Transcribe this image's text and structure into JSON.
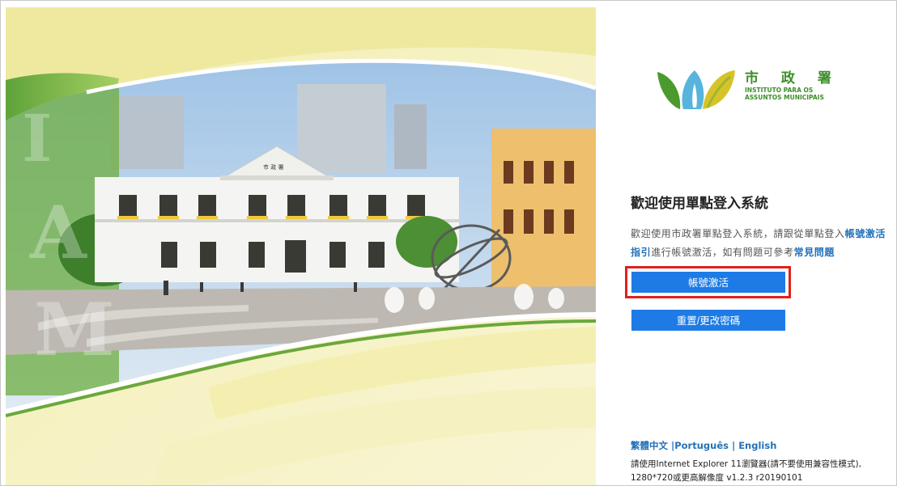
{
  "colors": {
    "accent": "#1e7be6",
    "link": "#2372b9",
    "highlight": "#e0201c",
    "brand_green": "#3c8f2a"
  },
  "logo": {
    "cn": "市 政 署",
    "pt_line1": "INSTITUTO PARA OS",
    "pt_line2": "ASSUNTOS MUNICIPAIS",
    "building_sign": "市 政 署"
  },
  "welcome": {
    "title": "歡迎使用單點登入系統",
    "text_prefix": "歡迎使用市政署單點登入系統，請跟從單點登入",
    "link_guide": "帳號激活指引",
    "text_middle": "進行帳號激活，如有問題可參考",
    "link_faq": "常見問題"
  },
  "buttons": {
    "activate": "帳號激活",
    "reset": "重置/更改密碼"
  },
  "languages": {
    "zh": "繁體中文",
    "pt": "Português",
    "en": "English",
    "sep1": " |",
    "sep2": " | "
  },
  "browser_note": "請使用Internet Explorer 11瀏覽器(請不要使用兼容性模式), 1280*720或更高解像度 v1.2.3 r20190101"
}
